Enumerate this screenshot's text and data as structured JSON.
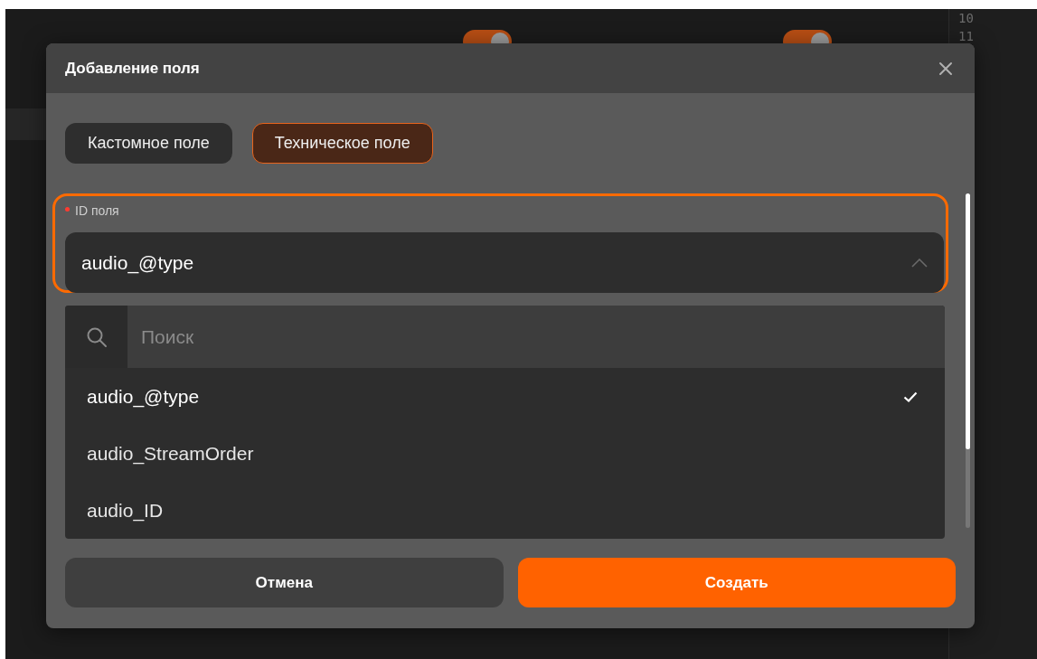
{
  "background": {
    "toggles": [
      {
        "on": true
      },
      {
        "on": true
      }
    ],
    "line_numbers": [
      "10",
      "11"
    ]
  },
  "dialog": {
    "title": "Добавление поля",
    "tabs": [
      {
        "label": "Кастомное поле",
        "selected": false
      },
      {
        "label": "Техническое поле",
        "selected": true
      }
    ],
    "field": {
      "label": "ID поля",
      "required": true,
      "focused": true,
      "value": "audio_@type",
      "expanded": true
    },
    "dropdown": {
      "search": {
        "placeholder": "Поиск"
      },
      "options": [
        {
          "label": "audio_@type",
          "selected": true
        },
        {
          "label": "audio_StreamOrder",
          "selected": false
        },
        {
          "label": "audio_ID",
          "selected": false
        }
      ]
    },
    "buttons": [
      {
        "label": "Отмена",
        "kind": "secondary"
      },
      {
        "label": "Создать",
        "kind": "primary"
      }
    ]
  }
}
